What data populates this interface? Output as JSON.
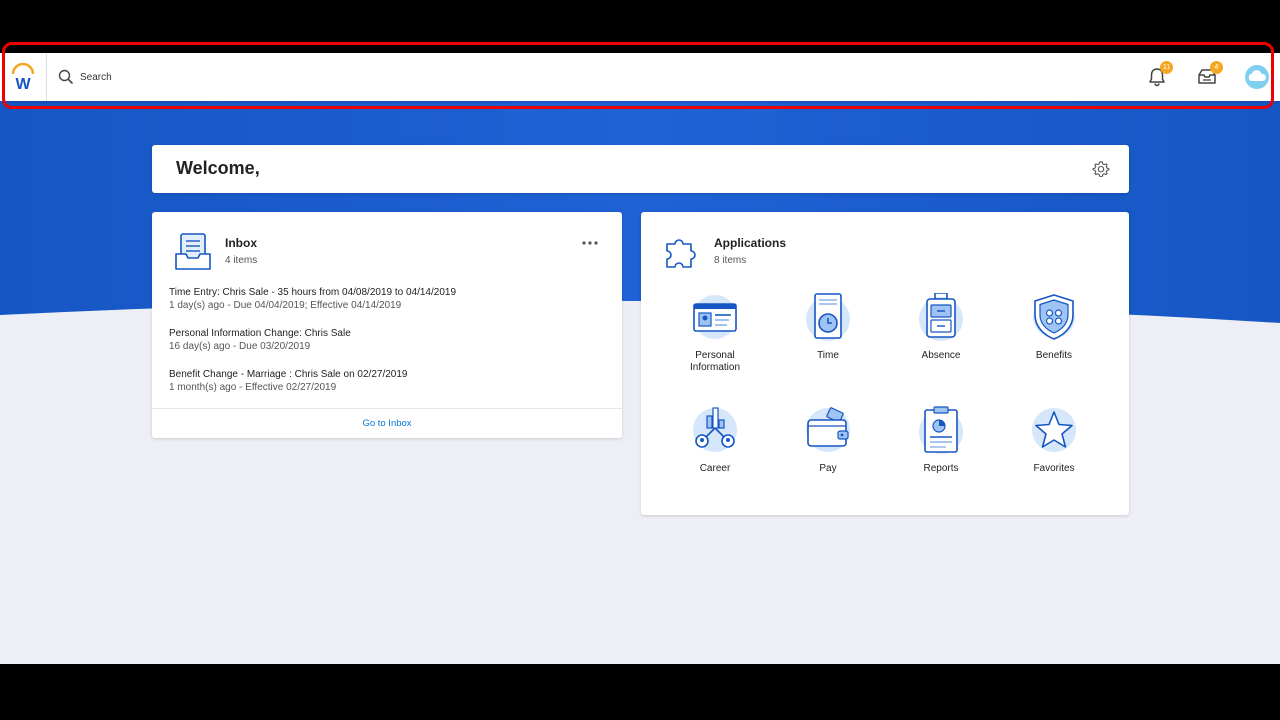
{
  "topbar": {
    "logo": "W",
    "search_placeholder": "Search",
    "notifications_count": "11",
    "inbox_count": "4"
  },
  "welcome": {
    "title": "Welcome,"
  },
  "inbox": {
    "title": "Inbox",
    "subtitle": "4 items",
    "tasks": [
      {
        "title": "Time Entry: Chris Sale - 35 hours from 04/08/2019 to 04/14/2019",
        "meta": "1 day(s) ago - Due 04/04/2019; Effective 04/14/2019"
      },
      {
        "title": "Personal Information Change: Chris Sale",
        "meta": "16 day(s) ago - Due 03/20/2019"
      },
      {
        "title": "Benefit Change - Marriage : Chris Sale on 02/27/2019",
        "meta": "1 month(s) ago - Effective 02/27/2019"
      }
    ],
    "footer_link": "Go to Inbox"
  },
  "applications": {
    "title": "Applications",
    "subtitle": "8 items",
    "items": [
      {
        "label": "Personal Information",
        "icon": "id-card-icon"
      },
      {
        "label": "Time",
        "icon": "time-clock-icon"
      },
      {
        "label": "Absence",
        "icon": "suitcase-icon"
      },
      {
        "label": "Benefits",
        "icon": "shield-icon"
      },
      {
        "label": "Career",
        "icon": "career-icon"
      },
      {
        "label": "Pay",
        "icon": "wallet-icon"
      },
      {
        "label": "Reports",
        "icon": "clipboard-report-icon"
      },
      {
        "label": "Favorites",
        "icon": "star-icon"
      }
    ]
  },
  "colors": {
    "brand_blue": "#1a5fc9",
    "accent_orange": "#f5a623",
    "link_blue": "#0875e1",
    "highlight_red": "#e00000"
  }
}
